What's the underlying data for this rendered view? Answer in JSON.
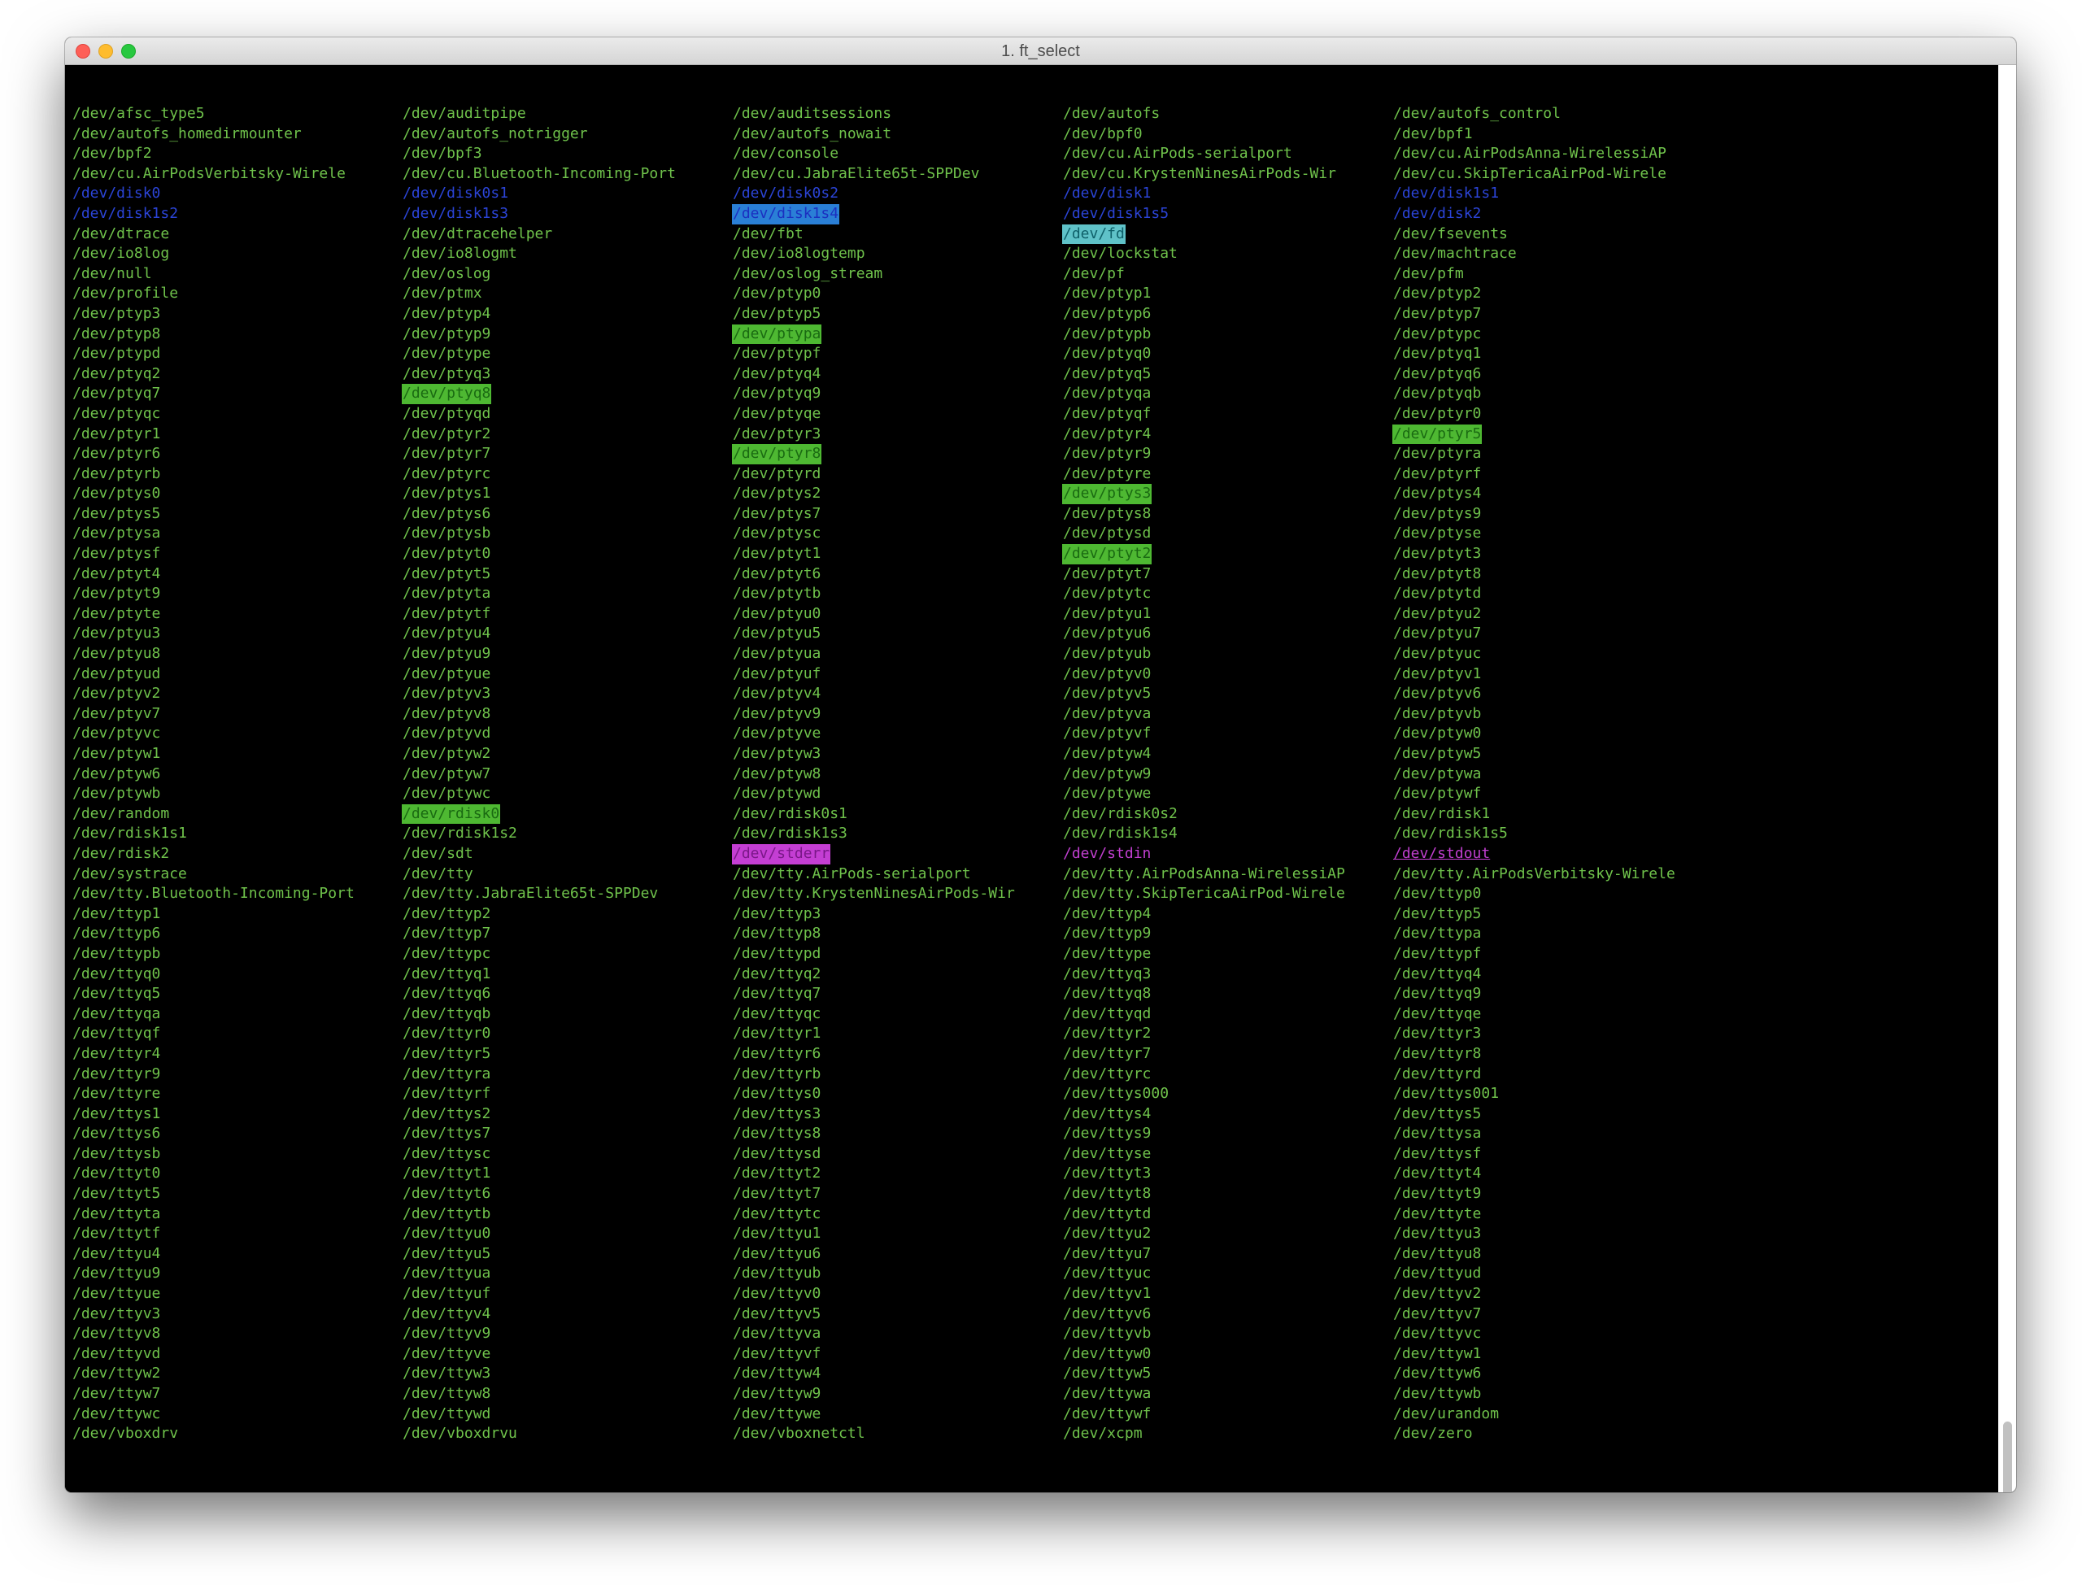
{
  "window": {
    "title": "1. ft_select"
  },
  "colors": {
    "background": "#000000",
    "default": "#6fc24b",
    "block": "#2b44d6",
    "highlight_green": "#4eb832",
    "highlight_blue": "#2a7fd6",
    "highlight_cyan": "#5fc2c8",
    "magenta": "#c03fcf"
  },
  "columns": [
    [
      {
        "t": "/dev/afsc_type5"
      },
      {
        "t": "/dev/autofs_homedirmounter"
      },
      {
        "t": "/dev/bpf2"
      },
      {
        "t": "/dev/cu.AirPodsVerbitsky-Wirele"
      },
      {
        "t": "/dev/disk0",
        "s": "blk"
      },
      {
        "t": "/dev/disk1s2",
        "s": "blk"
      },
      {
        "t": "/dev/dtrace"
      },
      {
        "t": "/dev/io8log"
      },
      {
        "t": "/dev/null"
      },
      {
        "t": "/dev/profile"
      },
      {
        "t": "/dev/ptyp3"
      },
      {
        "t": "/dev/ptyp8"
      },
      {
        "t": "/dev/ptypd"
      },
      {
        "t": "/dev/ptyq2"
      },
      {
        "t": "/dev/ptyq7"
      },
      {
        "t": "/dev/ptyqc"
      },
      {
        "t": "/dev/ptyr1"
      },
      {
        "t": "/dev/ptyr6"
      },
      {
        "t": "/dev/ptyrb"
      },
      {
        "t": "/dev/ptys0"
      },
      {
        "t": "/dev/ptys5"
      },
      {
        "t": "/dev/ptysa"
      },
      {
        "t": "/dev/ptysf"
      },
      {
        "t": "/dev/ptyt4"
      },
      {
        "t": "/dev/ptyt9"
      },
      {
        "t": "/dev/ptyte"
      },
      {
        "t": "/dev/ptyu3"
      },
      {
        "t": "/dev/ptyu8"
      },
      {
        "t": "/dev/ptyud"
      },
      {
        "t": "/dev/ptyv2"
      },
      {
        "t": "/dev/ptyv7"
      },
      {
        "t": "/dev/ptyvc"
      },
      {
        "t": "/dev/ptyw1"
      },
      {
        "t": "/dev/ptyw6"
      },
      {
        "t": "/dev/ptywb"
      },
      {
        "t": "/dev/random"
      },
      {
        "t": "/dev/rdisk1s1"
      },
      {
        "t": "/dev/rdisk2"
      },
      {
        "t": "/dev/systrace"
      },
      {
        "t": "/dev/tty.Bluetooth-Incoming-Port"
      },
      {
        "t": "/dev/ttyp1"
      },
      {
        "t": "/dev/ttyp6"
      },
      {
        "t": "/dev/ttypb"
      },
      {
        "t": "/dev/ttyq0"
      },
      {
        "t": "/dev/ttyq5"
      },
      {
        "t": "/dev/ttyqa"
      },
      {
        "t": "/dev/ttyqf"
      },
      {
        "t": "/dev/ttyr4"
      },
      {
        "t": "/dev/ttyr9"
      },
      {
        "t": "/dev/ttyre"
      },
      {
        "t": "/dev/ttys1"
      },
      {
        "t": "/dev/ttys6"
      },
      {
        "t": "/dev/ttysb"
      },
      {
        "t": "/dev/ttyt0"
      },
      {
        "t": "/dev/ttyt5"
      },
      {
        "t": "/dev/ttyta"
      },
      {
        "t": "/dev/ttytf"
      },
      {
        "t": "/dev/ttyu4"
      },
      {
        "t": "/dev/ttyu9"
      },
      {
        "t": "/dev/ttyue"
      },
      {
        "t": "/dev/ttyv3"
      },
      {
        "t": "/dev/ttyv8"
      },
      {
        "t": "/dev/ttyvd"
      },
      {
        "t": "/dev/ttyw2"
      },
      {
        "t": "/dev/ttyw7"
      },
      {
        "t": "/dev/ttywc"
      },
      {
        "t": "/dev/vboxdrv"
      }
    ],
    [
      {
        "t": "/dev/auditpipe"
      },
      {
        "t": "/dev/autofs_notrigger"
      },
      {
        "t": "/dev/bpf3"
      },
      {
        "t": "/dev/cu.Bluetooth-Incoming-Port"
      },
      {
        "t": "/dev/disk0s1",
        "s": "blk"
      },
      {
        "t": "/dev/disk1s3",
        "s": "blk"
      },
      {
        "t": "/dev/dtracehelper"
      },
      {
        "t": "/dev/io8logmt"
      },
      {
        "t": "/dev/oslog"
      },
      {
        "t": "/dev/ptmx"
      },
      {
        "t": "/dev/ptyp4"
      },
      {
        "t": "/dev/ptyp9"
      },
      {
        "t": "/dev/ptype"
      },
      {
        "t": "/dev/ptyq3"
      },
      {
        "t": "/dev/ptyq8",
        "s": "chr-hl"
      },
      {
        "t": "/dev/ptyqd"
      },
      {
        "t": "/dev/ptyr2"
      },
      {
        "t": "/dev/ptyr7"
      },
      {
        "t": "/dev/ptyrc"
      },
      {
        "t": "/dev/ptys1"
      },
      {
        "t": "/dev/ptys6"
      },
      {
        "t": "/dev/ptysb"
      },
      {
        "t": "/dev/ptyt0"
      },
      {
        "t": "/dev/ptyt5"
      },
      {
        "t": "/dev/ptyta"
      },
      {
        "t": "/dev/ptytf"
      },
      {
        "t": "/dev/ptyu4"
      },
      {
        "t": "/dev/ptyu9"
      },
      {
        "t": "/dev/ptyue"
      },
      {
        "t": "/dev/ptyv3"
      },
      {
        "t": "/dev/ptyv8"
      },
      {
        "t": "/dev/ptyvd"
      },
      {
        "t": "/dev/ptyw2"
      },
      {
        "t": "/dev/ptyw7"
      },
      {
        "t": "/dev/ptywc"
      },
      {
        "t": "/dev/rdisk0",
        "s": "chr-hl"
      },
      {
        "t": "/dev/rdisk1s2"
      },
      {
        "t": "/dev/sdt"
      },
      {
        "t": "/dev/tty"
      },
      {
        "t": "/dev/tty.JabraElite65t-SPPDev"
      },
      {
        "t": "/dev/ttyp2"
      },
      {
        "t": "/dev/ttyp7"
      },
      {
        "t": "/dev/ttypc"
      },
      {
        "t": "/dev/ttyq1"
      },
      {
        "t": "/dev/ttyq6"
      },
      {
        "t": "/dev/ttyqb"
      },
      {
        "t": "/dev/ttyr0"
      },
      {
        "t": "/dev/ttyr5"
      },
      {
        "t": "/dev/ttyra"
      },
      {
        "t": "/dev/ttyrf"
      },
      {
        "t": "/dev/ttys2"
      },
      {
        "t": "/dev/ttys7"
      },
      {
        "t": "/dev/ttysc"
      },
      {
        "t": "/dev/ttyt1"
      },
      {
        "t": "/dev/ttyt6"
      },
      {
        "t": "/dev/ttytb"
      },
      {
        "t": "/dev/ttyu0"
      },
      {
        "t": "/dev/ttyu5"
      },
      {
        "t": "/dev/ttyua"
      },
      {
        "t": "/dev/ttyuf"
      },
      {
        "t": "/dev/ttyv4"
      },
      {
        "t": "/dev/ttyv9"
      },
      {
        "t": "/dev/ttyve"
      },
      {
        "t": "/dev/ttyw3"
      },
      {
        "t": "/dev/ttyw8"
      },
      {
        "t": "/dev/ttywd"
      },
      {
        "t": "/dev/vboxdrvu"
      }
    ],
    [
      {
        "t": "/dev/auditsessions"
      },
      {
        "t": "/dev/autofs_nowait"
      },
      {
        "t": "/dev/console"
      },
      {
        "t": "/dev/cu.JabraElite65t-SPPDev"
      },
      {
        "t": "/dev/disk0s2",
        "s": "blk"
      },
      {
        "t": "/dev/disk1s4",
        "s": "blk-hl"
      },
      {
        "t": "/dev/fbt"
      },
      {
        "t": "/dev/io8logtemp"
      },
      {
        "t": "/dev/oslog_stream"
      },
      {
        "t": "/dev/ptyp0"
      },
      {
        "t": "/dev/ptyp5"
      },
      {
        "t": "/dev/ptypa",
        "s": "chr-hl"
      },
      {
        "t": "/dev/ptypf"
      },
      {
        "t": "/dev/ptyq4"
      },
      {
        "t": "/dev/ptyq9"
      },
      {
        "t": "/dev/ptyqe"
      },
      {
        "t": "/dev/ptyr3"
      },
      {
        "t": "/dev/ptyr8",
        "s": "chr-hl"
      },
      {
        "t": "/dev/ptyrd"
      },
      {
        "t": "/dev/ptys2"
      },
      {
        "t": "/dev/ptys7"
      },
      {
        "t": "/dev/ptysc"
      },
      {
        "t": "/dev/ptyt1"
      },
      {
        "t": "/dev/ptyt6"
      },
      {
        "t": "/dev/ptytb"
      },
      {
        "t": "/dev/ptyu0"
      },
      {
        "t": "/dev/ptyu5"
      },
      {
        "t": "/dev/ptyua"
      },
      {
        "t": "/dev/ptyuf"
      },
      {
        "t": "/dev/ptyv4"
      },
      {
        "t": "/dev/ptyv9"
      },
      {
        "t": "/dev/ptyve"
      },
      {
        "t": "/dev/ptyw3"
      },
      {
        "t": "/dev/ptyw8"
      },
      {
        "t": "/dev/ptywd"
      },
      {
        "t": "/dev/rdisk0s1"
      },
      {
        "t": "/dev/rdisk1s3"
      },
      {
        "t": "/dev/stderr",
        "s": "mag-hl"
      },
      {
        "t": "/dev/tty.AirPods-serialport"
      },
      {
        "t": "/dev/tty.KrystenNinesAirPods-Wir"
      },
      {
        "t": "/dev/ttyp3"
      },
      {
        "t": "/dev/ttyp8"
      },
      {
        "t": "/dev/ttypd"
      },
      {
        "t": "/dev/ttyq2"
      },
      {
        "t": "/dev/ttyq7"
      },
      {
        "t": "/dev/ttyqc"
      },
      {
        "t": "/dev/ttyr1"
      },
      {
        "t": "/dev/ttyr6"
      },
      {
        "t": "/dev/ttyrb"
      },
      {
        "t": "/dev/ttys0"
      },
      {
        "t": "/dev/ttys3"
      },
      {
        "t": "/dev/ttys8"
      },
      {
        "t": "/dev/ttysd"
      },
      {
        "t": "/dev/ttyt2"
      },
      {
        "t": "/dev/ttyt7"
      },
      {
        "t": "/dev/ttytc"
      },
      {
        "t": "/dev/ttyu1"
      },
      {
        "t": "/dev/ttyu6"
      },
      {
        "t": "/dev/ttyub"
      },
      {
        "t": "/dev/ttyv0"
      },
      {
        "t": "/dev/ttyv5"
      },
      {
        "t": "/dev/ttyva"
      },
      {
        "t": "/dev/ttyvf"
      },
      {
        "t": "/dev/ttyw4"
      },
      {
        "t": "/dev/ttyw9"
      },
      {
        "t": "/dev/ttywe"
      },
      {
        "t": "/dev/vboxnetctl"
      }
    ],
    [
      {
        "t": "/dev/autofs"
      },
      {
        "t": "/dev/bpf0"
      },
      {
        "t": "/dev/cu.AirPods-serialport"
      },
      {
        "t": "/dev/cu.KrystenNinesAirPods-Wir"
      },
      {
        "t": "/dev/disk1",
        "s": "blk"
      },
      {
        "t": "/dev/disk1s5",
        "s": "blk"
      },
      {
        "t": "/dev/fd",
        "s": "lnk-hl"
      },
      {
        "t": "/dev/lockstat"
      },
      {
        "t": "/dev/pf"
      },
      {
        "t": "/dev/ptyp1"
      },
      {
        "t": "/dev/ptyp6"
      },
      {
        "t": "/dev/ptypb"
      },
      {
        "t": "/dev/ptyq0"
      },
      {
        "t": "/dev/ptyq5"
      },
      {
        "t": "/dev/ptyqa"
      },
      {
        "t": "/dev/ptyqf"
      },
      {
        "t": "/dev/ptyr4"
      },
      {
        "t": "/dev/ptyr9"
      },
      {
        "t": "/dev/ptyre"
      },
      {
        "t": "/dev/ptys3",
        "s": "chr-hl"
      },
      {
        "t": "/dev/ptys8"
      },
      {
        "t": "/dev/ptysd"
      },
      {
        "t": "/dev/ptyt2",
        "s": "chr-hl"
      },
      {
        "t": "/dev/ptyt7"
      },
      {
        "t": "/dev/ptytc"
      },
      {
        "t": "/dev/ptyu1"
      },
      {
        "t": "/dev/ptyu6"
      },
      {
        "t": "/dev/ptyub"
      },
      {
        "t": "/dev/ptyv0"
      },
      {
        "t": "/dev/ptyv5"
      },
      {
        "t": "/dev/ptyva"
      },
      {
        "t": "/dev/ptyvf"
      },
      {
        "t": "/dev/ptyw4"
      },
      {
        "t": "/dev/ptyw9"
      },
      {
        "t": "/dev/ptywe"
      },
      {
        "t": "/dev/rdisk0s2"
      },
      {
        "t": "/dev/rdisk1s4"
      },
      {
        "t": "/dev/stdin",
        "s": "mag"
      },
      {
        "t": "/dev/tty.AirPodsAnna-WirelessiAP"
      },
      {
        "t": "/dev/tty.SkipTericaAirPod-Wirele"
      },
      {
        "t": "/dev/ttyp4"
      },
      {
        "t": "/dev/ttyp9"
      },
      {
        "t": "/dev/ttype"
      },
      {
        "t": "/dev/ttyq3"
      },
      {
        "t": "/dev/ttyq8"
      },
      {
        "t": "/dev/ttyqd"
      },
      {
        "t": "/dev/ttyr2"
      },
      {
        "t": "/dev/ttyr7"
      },
      {
        "t": "/dev/ttyrc"
      },
      {
        "t": "/dev/ttys000"
      },
      {
        "t": "/dev/ttys4"
      },
      {
        "t": "/dev/ttys9"
      },
      {
        "t": "/dev/ttyse"
      },
      {
        "t": "/dev/ttyt3"
      },
      {
        "t": "/dev/ttyt8"
      },
      {
        "t": "/dev/ttytd"
      },
      {
        "t": "/dev/ttyu2"
      },
      {
        "t": "/dev/ttyu7"
      },
      {
        "t": "/dev/ttyuc"
      },
      {
        "t": "/dev/ttyv1"
      },
      {
        "t": "/dev/ttyv6"
      },
      {
        "t": "/dev/ttyvb"
      },
      {
        "t": "/dev/ttyw0"
      },
      {
        "t": "/dev/ttyw5"
      },
      {
        "t": "/dev/ttywa"
      },
      {
        "t": "/dev/ttywf"
      },
      {
        "t": "/dev/xcpm"
      }
    ],
    [
      {
        "t": "/dev/autofs_control"
      },
      {
        "t": "/dev/bpf1"
      },
      {
        "t": "/dev/cu.AirPodsAnna-WirelessiAP"
      },
      {
        "t": "/dev/cu.SkipTericaAirPod-Wirele"
      },
      {
        "t": "/dev/disk1s1",
        "s": "blk"
      },
      {
        "t": "/dev/disk2",
        "s": "blk"
      },
      {
        "t": "/dev/fsevents"
      },
      {
        "t": "/dev/machtrace"
      },
      {
        "t": "/dev/pfm"
      },
      {
        "t": "/dev/ptyp2"
      },
      {
        "t": "/dev/ptyp7"
      },
      {
        "t": "/dev/ptypc"
      },
      {
        "t": "/dev/ptyq1"
      },
      {
        "t": "/dev/ptyq6"
      },
      {
        "t": "/dev/ptyqb"
      },
      {
        "t": "/dev/ptyr0"
      },
      {
        "t": "/dev/ptyr5",
        "s": "chr-hl"
      },
      {
        "t": "/dev/ptyra"
      },
      {
        "t": "/dev/ptyrf"
      },
      {
        "t": "/dev/ptys4"
      },
      {
        "t": "/dev/ptys9"
      },
      {
        "t": "/dev/ptyse"
      },
      {
        "t": "/dev/ptyt3"
      },
      {
        "t": "/dev/ptyt8"
      },
      {
        "t": "/dev/ptytd"
      },
      {
        "t": "/dev/ptyu2"
      },
      {
        "t": "/dev/ptyu7"
      },
      {
        "t": "/dev/ptyuc"
      },
      {
        "t": "/dev/ptyv1"
      },
      {
        "t": "/dev/ptyv6"
      },
      {
        "t": "/dev/ptyvb"
      },
      {
        "t": "/dev/ptyw0"
      },
      {
        "t": "/dev/ptyw5"
      },
      {
        "t": "/dev/ptywa"
      },
      {
        "t": "/dev/ptywf"
      },
      {
        "t": "/dev/rdisk1"
      },
      {
        "t": "/dev/rdisk1s5"
      },
      {
        "t": "/dev/stdout",
        "s": "mag-u"
      },
      {
        "t": "/dev/tty.AirPodsVerbitsky-Wirele"
      },
      {
        "t": "/dev/ttyp0"
      },
      {
        "t": "/dev/ttyp5"
      },
      {
        "t": "/dev/ttypa"
      },
      {
        "t": "/dev/ttypf"
      },
      {
        "t": "/dev/ttyq4"
      },
      {
        "t": "/dev/ttyq9"
      },
      {
        "t": "/dev/ttyqe"
      },
      {
        "t": "/dev/ttyr3"
      },
      {
        "t": "/dev/ttyr8"
      },
      {
        "t": "/dev/ttyrd"
      },
      {
        "t": "/dev/ttys001"
      },
      {
        "t": "/dev/ttys5"
      },
      {
        "t": "/dev/ttysa"
      },
      {
        "t": "/dev/ttysf"
      },
      {
        "t": "/dev/ttyt4"
      },
      {
        "t": "/dev/ttyt9"
      },
      {
        "t": "/dev/ttyte"
      },
      {
        "t": "/dev/ttyu3"
      },
      {
        "t": "/dev/ttyu8"
      },
      {
        "t": "/dev/ttyud"
      },
      {
        "t": "/dev/ttyv2"
      },
      {
        "t": "/dev/ttyv7"
      },
      {
        "t": "/dev/ttyvc"
      },
      {
        "t": "/dev/ttyw1"
      },
      {
        "t": "/dev/ttyw6"
      },
      {
        "t": "/dev/ttywb"
      },
      {
        "t": "/dev/urandom"
      },
      {
        "t": "/dev/zero"
      }
    ]
  ]
}
